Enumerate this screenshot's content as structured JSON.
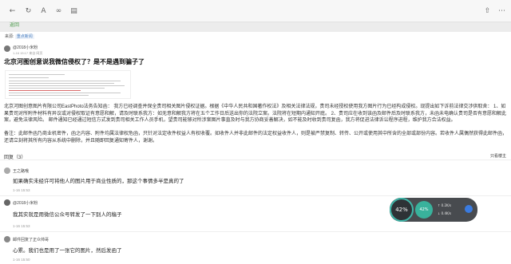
{
  "toolbar": {
    "icons": [
      "back-icon",
      "refresh-icon",
      "font-icon",
      "link-icon",
      "reader-icon",
      "share-icon",
      "more-icon"
    ]
  },
  "back_link": "返回",
  "breadcrumb": {
    "prefix": "来源:",
    "crumb": "重点新闻"
  },
  "post": {
    "author": "@2018小米粉",
    "date": "1-16 15:17  来自 网页",
    "title": "北京河图创意说我微信侵权了？是不是遇到骗子了",
    "body": "北京河图创意图片有限公司EastPhoto法务告知函： 我方已经调查并保全贵司相关图片侵权证据。根据《中华人民共和国著作权法》及相关法律法规，贵司未经授权使用我方图片行为已经构成侵权。现提出如下诉前法律交涉供取舍： 1、如果贵司对所附件材料有异议或对侵权取证有意愿和解，请及时联系我方：如无意和解我方将在五个工作日后送出你的法院立案。法院将在短期内通知开庭。 2、贵司应在收到该函及邮件后及时联系我方，未函未电确认贵司是否有意愿和解此案，避免法律风险。 邮件通知已经通过短信方式发到贵司相关工作人员手机，望贵司能够对所涉案图片事直及时与我方协商妥善解决，如不能及时收到贵司复函，我方将促进法律诉讼程序进程，维护我方合法权益。",
    "body2": "备注：此邮件函乃商业机密件，函之内容、附件均属法律权危函，只针对法定收件权益人有权收覆。如收件人并非此邮件的法定权益收件人，则是被严禁复制、转传、公开或使用其中所含的全部或部份内容。若收件人属偶然获得此邮件函，还请立刻将其所有内容从系统中删除，并且随即回复通知寄件人，谢谢。"
  },
  "replies": {
    "header": "回复（3）",
    "sort": "只看楼主",
    "items": [
      {
        "author": "王之路哦",
        "text": "如果确实未经许可将他人的图片用于商业性质的，那这个事情多半是真的了",
        "time": "1-16 15:53"
      },
      {
        "author": "@2018小米粉",
        "text": "我其实就是用微信公众号转发了一下别人的稿子",
        "time": "1-16 15:53"
      },
      {
        "author": "邮件回复了正众帅哥",
        "text": "心累。我们也是用了一张它的图片，然后发函了",
        "time": "1-16 15:50"
      }
    ]
  },
  "widget": {
    "cpu": "42%",
    "mem": "42%",
    "upload": "0.2K/s",
    "download": "0.4K/s"
  }
}
